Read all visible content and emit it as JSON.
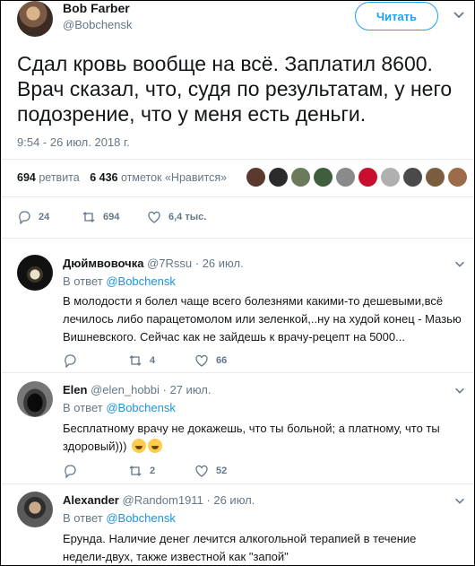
{
  "tweet": {
    "author_name": "Bob Farber",
    "author_handle": "@Bobchensk",
    "follow_label": "Читать",
    "text": "Сдал кровь вообще на всё. Заплатил 8600. Врач сказал, что, судя по результатам, у него подозрение, что у меня есть деньги.",
    "date": "9:54 - 26 июл. 2018 г.",
    "retweets_count": "694",
    "retweets_label": "ретвита",
    "likes_count": "6 436",
    "likes_label": "отметок «Нравится»",
    "actions": {
      "replies": "24",
      "retweets": "694",
      "likes": "6,4 тыс."
    }
  },
  "replies": [
    {
      "name": "Дюймвовочка",
      "handle": "@7Rssu",
      "date": "· 26 июл.",
      "reply_to_prefix": "В ответ",
      "reply_to": "@Bobchensk",
      "text": "В молодости я болел чаще всего болезнями какими-то дешевыми,всё лечилось либо парацетомолом или зеленкой,..ну на худой конец - Мазью Вишневского. Сейчас как не зайдешь к врачу-рецепт на 5000...",
      "replies": "",
      "retweets": "4",
      "likes": "66"
    },
    {
      "name": "Elen",
      "handle": "@elen_hobbi",
      "date": "· 27 июл.",
      "reply_to_prefix": "В ответ",
      "reply_to": "@Bobchensk",
      "text": "Бесплатному врачу не докажешь, что ты больной; а платному, что ты здоровый)))",
      "replies": "",
      "retweets": "2",
      "likes": "52"
    },
    {
      "name": "Alexander",
      "handle": "@Random1911",
      "date": "· 26 июл.",
      "reply_to_prefix": "В ответ",
      "reply_to": "@Bobchensk",
      "text": "Ерунда. Наличие денег лечится алкогольной терапией в течение недели-двух, также известной как \"запой\""
    }
  ],
  "colors": {
    "accent": "#1da1f2",
    "link": "#1b95e0",
    "muted": "#657786",
    "text": "#14171a",
    "divider": "#e6ecf0"
  }
}
